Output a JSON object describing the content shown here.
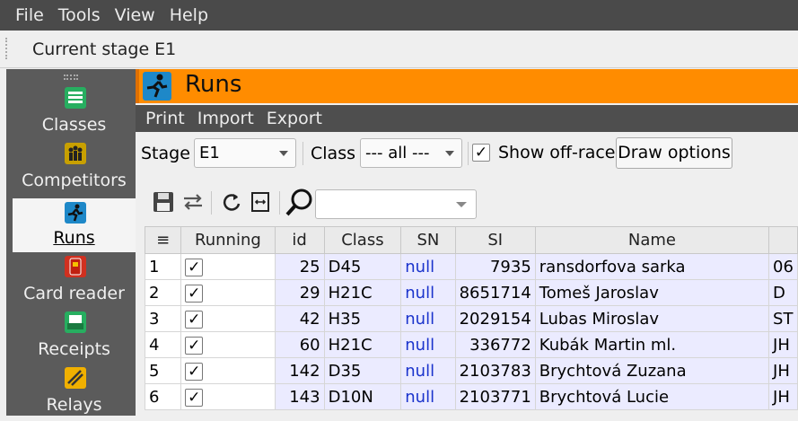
{
  "menu": [
    "File",
    "Tools",
    "View",
    "Help"
  ],
  "stage_bar": {
    "title": "Current stage E1"
  },
  "sidebar": {
    "items": [
      {
        "label": "Classes",
        "icon": "classes-icon",
        "color": "#27ae60"
      },
      {
        "label": "Competitors",
        "icon": "competitors-icon",
        "color": "#c8a000"
      },
      {
        "label": "Runs",
        "icon": "runs-icon",
        "color": "#1e88c8"
      },
      {
        "label": "Card reader",
        "icon": "card-reader-icon",
        "color": "#d03020"
      },
      {
        "label": "Receipts",
        "icon": "receipts-icon",
        "color": "#27ae60"
      },
      {
        "label": "Relays",
        "icon": "relays-icon",
        "color": "#f0b000"
      }
    ],
    "active": "Runs"
  },
  "runs": {
    "title": "Runs",
    "submenu": [
      "Print",
      "Import",
      "Export"
    ],
    "filters": {
      "stage_label": "Stage",
      "stage_value": "E1",
      "class_label": "Class",
      "class_value": "--- all ---",
      "show_offrace_label": "Show off-race",
      "show_offrace_checked": "✓",
      "draw_options": "Draw options"
    },
    "search_placeholder": ""
  },
  "table": {
    "headers": [
      "≡",
      "Running",
      "id",
      "Class",
      "SN",
      "SI",
      "Name",
      ""
    ],
    "rows": [
      {
        "n": "1",
        "running": "✓",
        "id": "25",
        "class": "D45",
        "sn": "null",
        "si": "7935",
        "name": "ransdorfova sarka",
        "extra": "06"
      },
      {
        "n": "2",
        "running": "✓",
        "id": "29",
        "class": "H21C",
        "sn": "null",
        "si": "8651714",
        "name": "Tomeš Jaroslav",
        "extra": "D"
      },
      {
        "n": "3",
        "running": "✓",
        "id": "42",
        "class": "H35",
        "sn": "null",
        "si": "2029154",
        "name": "Lubas Miroslav",
        "extra": "ST"
      },
      {
        "n": "4",
        "running": "✓",
        "id": "60",
        "class": "H21C",
        "sn": "null",
        "si": "336772",
        "name": "Kubák Martin ml.",
        "extra": "JH"
      },
      {
        "n": "5",
        "running": "✓",
        "id": "142",
        "class": "D35",
        "sn": "null",
        "si": "2103783",
        "name": "Brychtová Zuzana",
        "extra": "JH"
      },
      {
        "n": "6",
        "running": "✓",
        "id": "143",
        "class": "D10N",
        "sn": "null",
        "si": "2103771",
        "name": "Brychtová Lucie",
        "extra": "JH"
      }
    ]
  }
}
